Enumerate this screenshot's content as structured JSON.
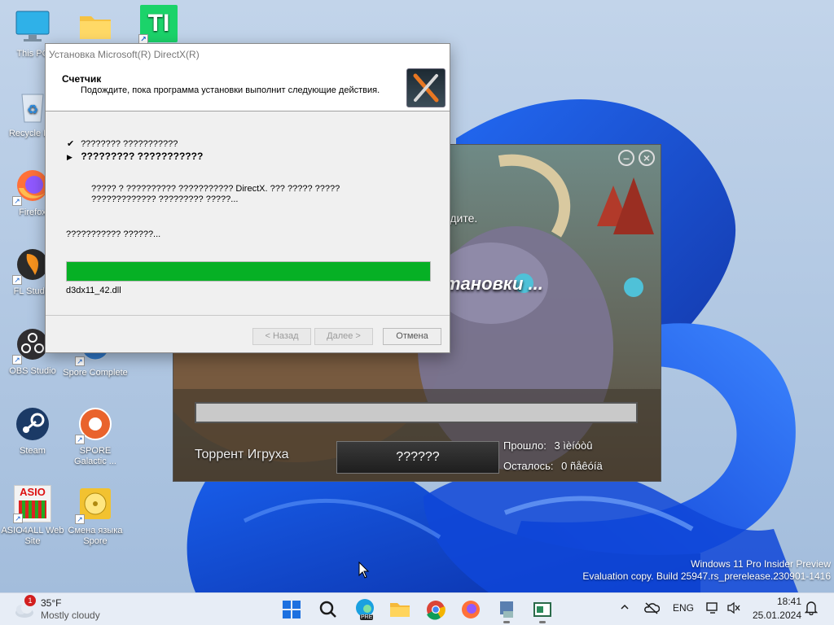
{
  "desktop": {
    "icons": [
      {
        "label": "This PC"
      },
      {
        "label": ""
      },
      {
        "label": ""
      },
      {
        "label": "Recycle Bin"
      },
      {
        "label": "Firefox"
      },
      {
        "label": "FL Studio"
      },
      {
        "label": "OBS Studio"
      },
      {
        "label": "Spore Complete"
      },
      {
        "label": "Steam"
      },
      {
        "label": "SPORE Galactic ..."
      },
      {
        "label": "ASIO4ALL Web Site"
      },
      {
        "label": "Смена языка Spore"
      }
    ],
    "tl_glyph": "TI",
    "asio_glyph": "ASIO"
  },
  "dx_dialog": {
    "title": "Установка Microsoft(R) DirectX(R)",
    "heading": "Счетчик",
    "subheading": "Подождите, пока программа установки выполнит следующие действия.",
    "steps": [
      {
        "mark": "✔",
        "text": "???????? ???????????"
      },
      {
        "mark": "▶",
        "text": "????????? ???????????"
      }
    ],
    "detail": "????? ? ?????????? ??????????? DirectX. ??? ????? ????? ????????????? ????????? ?????...",
    "status": "??????????? ??????...",
    "progress": 1.0,
    "file": "d3dx11_42.dll",
    "back_label": "< Назад",
    "next_label": "Далее >",
    "cancel_label": "Отмена",
    "progress_color": "#06b025"
  },
  "installer": {
    "behind_text_1": "ждите.",
    "behind_text_2": "тановки ...",
    "minimize_glyph": "–",
    "close_glyph": "×",
    "brand": "Торрент Игруха",
    "button_label": "??????",
    "elapsed_label": "Прошло:",
    "elapsed_value": "3 ìèíóòû",
    "remaining_label": "Осталось:",
    "remaining_value": "0 ñåêóíä",
    "progress": 0.0
  },
  "watermark": {
    "line1": "Windows 11 Pro Insider Preview",
    "line2": "Evaluation copy. Build 25947.rs_prerelease.230901-1416"
  },
  "taskbar": {
    "weather_temp": "35°F",
    "weather_desc": "Mostly cloudy",
    "weather_badge": "1",
    "language": "ENG",
    "time": "18:41",
    "date": "25.01.2024",
    "edge_badge": "PRE"
  }
}
